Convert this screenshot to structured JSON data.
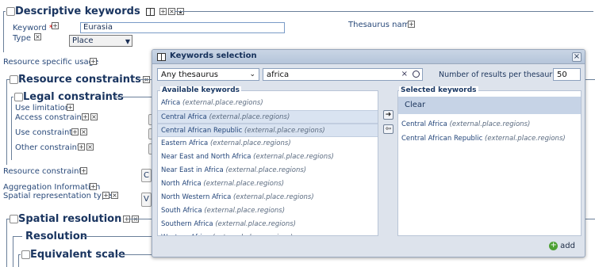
{
  "form": {
    "descriptive_keywords_title": "Descriptive keywords",
    "keyword_label": "Keyword",
    "keyword_required": "*",
    "keyword_value": "Eurasia",
    "type_label": "Type",
    "type_value": "Place",
    "thesaurus_name_label": "Thesaurus name",
    "resource_specific_usage_label": "Resource specific usage",
    "resource_constraints_title": "Resource constraints",
    "legal_constraints_title": "Legal constraints",
    "use_limitation_label": "Use limitation",
    "access_constraints_label": "Access constraints",
    "use_constraints_label": "Use constraints",
    "other_constraints_label": "Other constraints",
    "resource_constraints_label": "Resource constraints",
    "aggregation_information_label": "Aggregation Information",
    "spatial_representation_type_label": "Spatial representation type",
    "spatial_resolution_title": "Spatial resolution",
    "resolution_title": "Resolution",
    "equivalent_scale_title": "Equivalent scale"
  },
  "dialog": {
    "title": "Keywords selection",
    "close_glyph": "×",
    "thesaurus_select_value": "Any thesaurus",
    "search_value": "africa",
    "results_label": "Number of results per thesaurus",
    "results_value": "50",
    "available_legend": "Available keywords",
    "selected_legend": "Selected keywords",
    "clear_label": "Clear",
    "add_label": "add",
    "available_items": [
      {
        "name": "Africa",
        "scope": "(external.place.regions)",
        "selected": false
      },
      {
        "name": "Central Africa",
        "scope": "(external.place.regions)",
        "selected": true
      },
      {
        "name": "Central African Republic",
        "scope": "(external.place.regions)",
        "selected": true
      },
      {
        "name": "Eastern Africa",
        "scope": "(external.place.regions)",
        "selected": false
      },
      {
        "name": "Near East and North Africa",
        "scope": "(external.place.regions)",
        "selected": false
      },
      {
        "name": "Near East in Africa",
        "scope": "(external.place.regions)",
        "selected": false
      },
      {
        "name": "North Africa",
        "scope": "(external.place.regions)",
        "selected": false
      },
      {
        "name": "North Western Africa",
        "scope": "(external.place.regions)",
        "selected": false
      },
      {
        "name": "South Africa",
        "scope": "(external.place.regions)",
        "selected": false
      },
      {
        "name": "Southern Africa",
        "scope": "(external.place.regions)",
        "selected": false
      },
      {
        "name": "Western Africa",
        "scope": "(external.place.regions)",
        "selected": false
      }
    ],
    "selected_items": [
      {
        "name": "Central Africa",
        "scope": "(external.place.regions)"
      },
      {
        "name": "Central African Republic",
        "scope": "(external.place.regions)"
      }
    ]
  }
}
